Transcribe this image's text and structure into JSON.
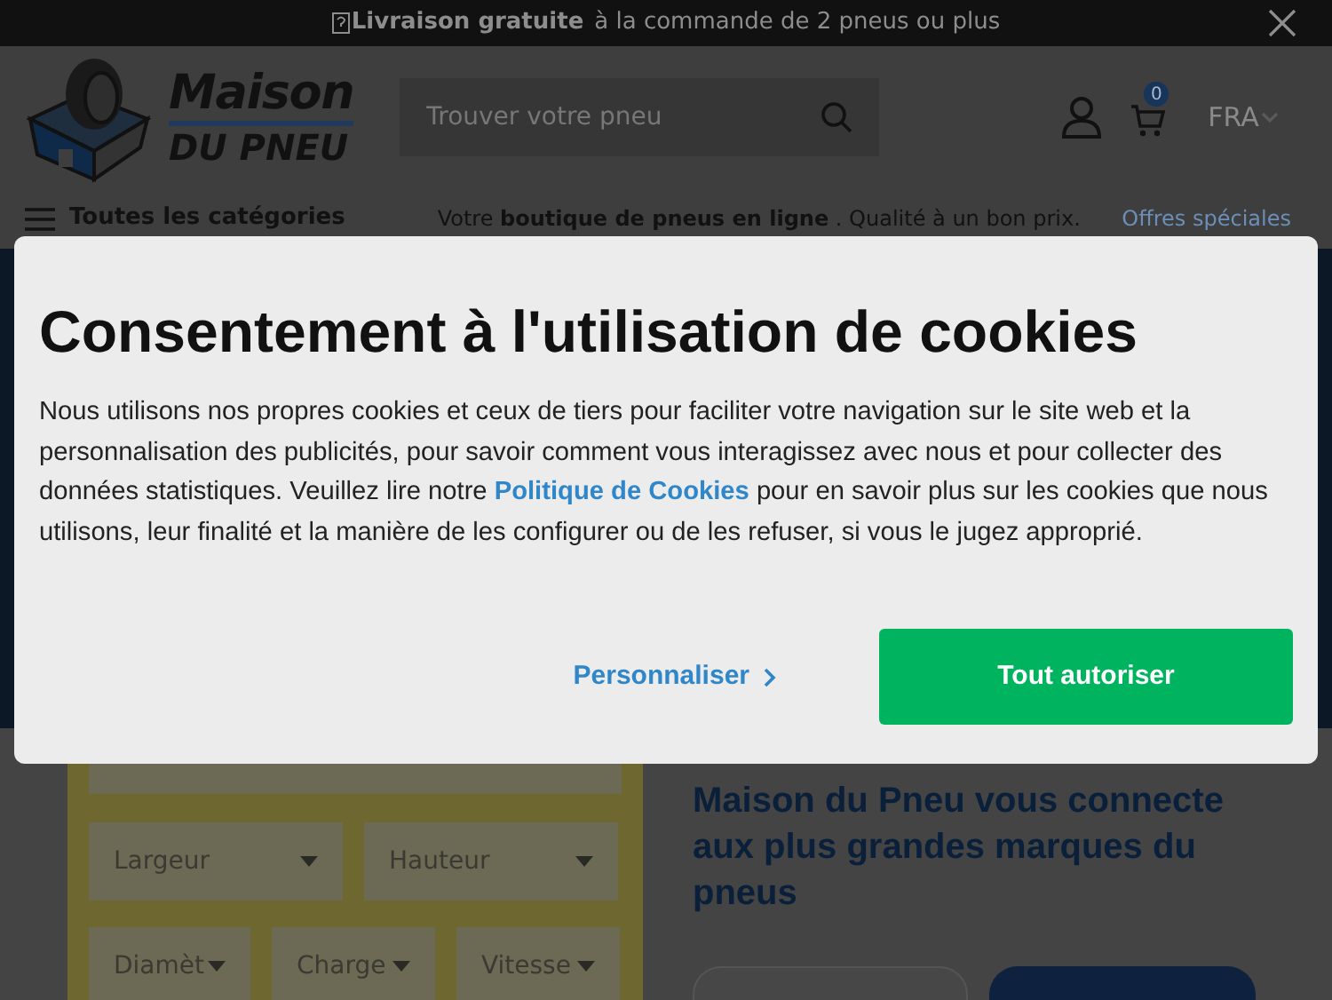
{
  "promo_bar": {
    "bold": "Livraison gratuite",
    "text": "à la commande de 2 pneus ou plus"
  },
  "header": {
    "logo_line1": "Maison",
    "logo_line2": "DU PNEU",
    "search": {
      "placeholder": "Trouver votre pneu"
    },
    "cart_count": "0",
    "language": "FRA"
  },
  "nav": {
    "categories": "Toutes les catégories",
    "tagline": "Votre **boutique de pneus en ligne** . Qualité à un bon prix.",
    "offers": "Offres spéciales"
  },
  "tire_finder": {
    "row_1": [
      {
        "label": "Largeur"
      },
      {
        "label": "Hauteur"
      }
    ],
    "row_2": [
      {
        "label": "Diamèt"
      },
      {
        "label": "Charge"
      },
      {
        "label": "Vitesse"
      }
    ]
  },
  "brands_heading": "Maison du Pneu vous connecte aux plus grandes marques du pneus",
  "cookie_dialog": {
    "title": "Consentement à l'utilisation de cookies",
    "body_before": "Nous utilisons nos propres cookies et ceux de tiers pour faciliter votre navigation sur le site web et la personnalisation des publicités, pour savoir comment vous interagissez avec nous et pour collecter des données statistiques. Veuillez lire notre",
    "link": "Politique de Cookies",
    "body_after": "pour en savoir plus sur les cookies que nous utilisons, leur finalité et la manière de les configurer ou de les refuser, si vous le jugez approprié.",
    "buttons": [
      {
        "label": "Personnaliser",
        "kind": "link"
      },
      {
        "label": "Tout autoriser",
        "kind": "primary"
      }
    ]
  }
}
